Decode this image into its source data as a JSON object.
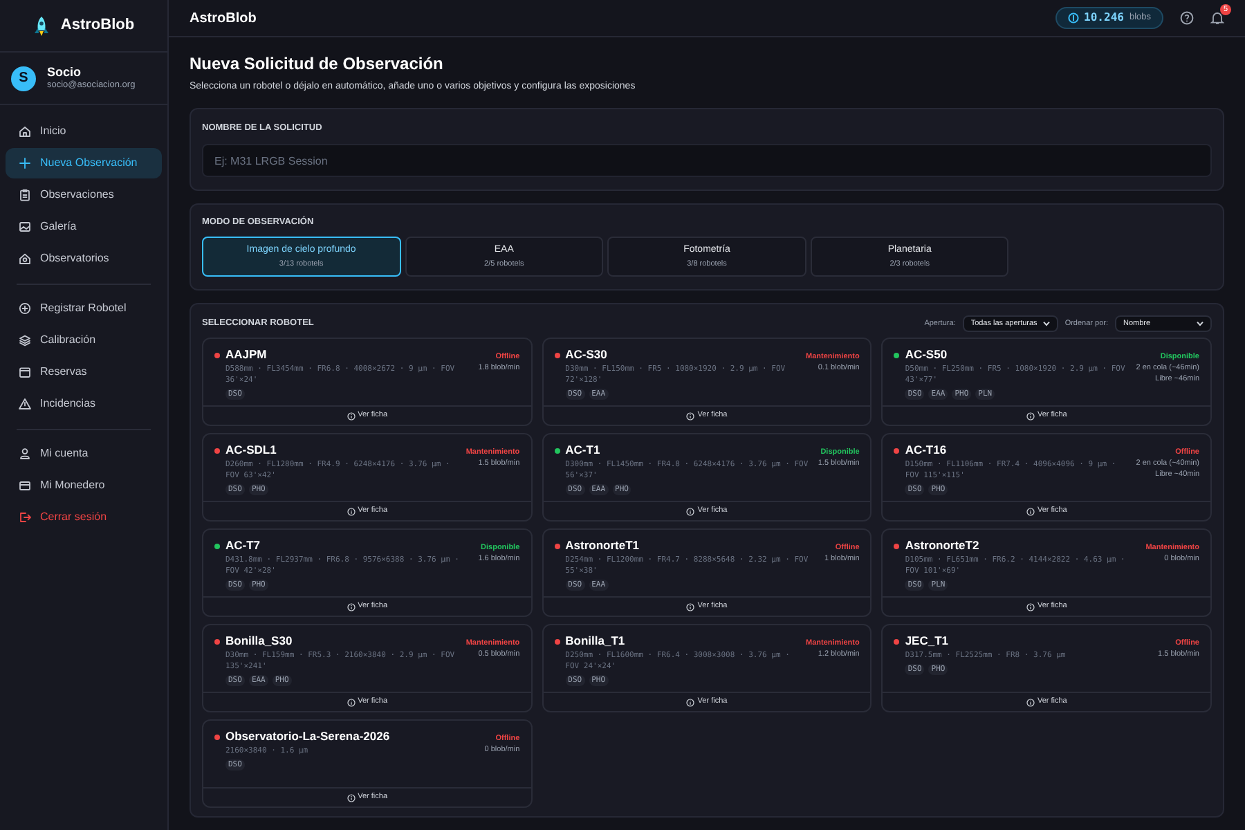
{
  "app": {
    "name": "AstroBlob"
  },
  "user": {
    "initial": "S",
    "name": "Socio",
    "email": "socio@asociacion.org"
  },
  "sidebar": {
    "sections": [
      {
        "items": [
          {
            "label": "Inicio",
            "selected": false,
            "kind": "normal"
          },
          {
            "label": "Nueva Observación",
            "selected": true,
            "kind": "normal"
          },
          {
            "label": "Observaciones",
            "selected": false,
            "kind": "normal"
          },
          {
            "label": "Galería",
            "selected": false,
            "kind": "normal"
          },
          {
            "label": "Observatorios",
            "selected": false,
            "kind": "normal"
          }
        ]
      },
      {
        "items": [
          {
            "label": "Registrar Robotel",
            "selected": false,
            "kind": "normal"
          },
          {
            "label": "Calibración",
            "selected": false,
            "kind": "normal"
          },
          {
            "label": "Reservas",
            "selected": false,
            "kind": "normal"
          },
          {
            "label": "Incidencias",
            "selected": false,
            "kind": "normal"
          }
        ]
      },
      {
        "items": [
          {
            "label": "Mi cuenta",
            "selected": false,
            "kind": "normal"
          },
          {
            "label": "Mi Monedero",
            "selected": false,
            "kind": "normal"
          },
          {
            "label": "Cerrar sesión",
            "selected": false,
            "kind": "danger"
          }
        ]
      }
    ]
  },
  "header": {
    "title": "AstroBlob",
    "balance": "10.246",
    "balance_unit": "blobs",
    "notifications": "5"
  },
  "page": {
    "title": "Nueva Solicitud de Observación",
    "subtitle": "Selecciona un robotel o déjalo en automático, añade uno o varios objetivos y configura las exposiciones"
  },
  "name_panel": {
    "label": "NOMBRE DE LA SOLICITUD",
    "placeholder": "Ej: M31 LRGB Session"
  },
  "mode_panel": {
    "label": "MODO DE OBSERVACIÓN",
    "modes": [
      {
        "label": "Imagen de cielo profundo",
        "count": "3/13 robotels",
        "selected": true
      },
      {
        "label": "EAA",
        "count": "2/5 robotels",
        "selected": false
      },
      {
        "label": "Fotometría",
        "count": "3/8 robotels",
        "selected": false
      },
      {
        "label": "Planetaria",
        "count": "2/3 robotels",
        "selected": false
      }
    ]
  },
  "robot_panel": {
    "label": "SELECCIONAR ROBOTEL",
    "aperture_label": "Apertura:",
    "aperture_value": "Todas las aperturas",
    "sort_label": "Ordenar por:",
    "sort_value": "Nombre",
    "robots": [
      {
        "name": "AAJPM",
        "specs": "D588mm · FL3454mm · FR6.8 · 4008×2672 · 9 µm · FOV 36'×24'",
        "tags": [
          "DSO"
        ],
        "status": "Offline",
        "color": "#ef4444",
        "details": [
          "1.8 blob/min"
        ],
        "link": "Ver ficha"
      },
      {
        "name": "AC-S30",
        "specs": "D30mm · FL150mm · FR5 · 1080×1920 · 2.9 µm · FOV 72'×128'",
        "tags": [
          "DSO",
          "EAA"
        ],
        "status": "Mantenimiento",
        "color": "#ef4444",
        "details": [
          "0.1 blob/min"
        ],
        "link": "Ver ficha"
      },
      {
        "name": "AC-S50",
        "specs": "D50mm · FL250mm · FR5 · 1080×1920 · 2.9 µm · FOV 43'×77'",
        "tags": [
          "DSO",
          "EAA",
          "PHO",
          "PLN"
        ],
        "status": "Disponible",
        "color": "#22c55e",
        "details": [
          "2 en cola (~46min)",
          "Libre ~46min"
        ],
        "link": "Ver ficha"
      },
      {
        "name": "AC-SDL1",
        "specs": "D260mm · FL1280mm · FR4.9 · 6248×4176 · 3.76 µm · FOV 63'×42'",
        "tags": [
          "DSO",
          "PHO"
        ],
        "status": "Mantenimiento",
        "color": "#ef4444",
        "details": [
          "1.5 blob/min"
        ],
        "link": "Ver ficha"
      },
      {
        "name": "AC-T1",
        "specs": "D300mm · FL1450mm · FR4.8 · 6248×4176 · 3.76 µm · FOV 56'×37'",
        "tags": [
          "DSO",
          "EAA",
          "PHO"
        ],
        "status": "Disponible",
        "color": "#22c55e",
        "details": [
          "1.5 blob/min"
        ],
        "link": "Ver ficha"
      },
      {
        "name": "AC-T16",
        "specs": "D150mm · FL1106mm · FR7.4 · 4096×4096 · 9 µm · FOV 115'×115'",
        "tags": [
          "DSO",
          "PHO"
        ],
        "status": "Offline",
        "color": "#ef4444",
        "details": [
          "2 en cola (~40min)",
          "Libre ~40min"
        ],
        "link": "Ver ficha"
      },
      {
        "name": "AC-T7",
        "specs": "D431.8mm · FL2937mm · FR6.8 · 9576×6388 · 3.76 µm · FOV 42'×28'",
        "tags": [
          "DSO",
          "PHO"
        ],
        "status": "Disponible",
        "color": "#22c55e",
        "details": [
          "1.6 blob/min"
        ],
        "link": "Ver ficha"
      },
      {
        "name": "AstronorteT1",
        "specs": "D254mm · FL1200mm · FR4.7 · 8288×5648 · 2.32 µm · FOV 55'×38'",
        "tags": [
          "DSO",
          "EAA"
        ],
        "status": "Offline",
        "color": "#ef4444",
        "details": [
          "1 blob/min"
        ],
        "link": "Ver ficha"
      },
      {
        "name": "AstronorteT2",
        "specs": "D105mm · FL651mm · FR6.2 · 4144×2822 · 4.63 µm · FOV 101'×69'",
        "tags": [
          "DSO",
          "PLN"
        ],
        "status": "Mantenimiento",
        "color": "#ef4444",
        "details": [
          "0 blob/min"
        ],
        "link": "Ver ficha"
      },
      {
        "name": "Bonilla_S30",
        "specs": "D30mm · FL159mm · FR5.3 · 2160×3840 · 2.9 µm · FOV 135'×241'",
        "tags": [
          "DSO",
          "EAA",
          "PHO"
        ],
        "status": "Mantenimiento",
        "color": "#ef4444",
        "details": [
          "0.5 blob/min"
        ],
        "link": "Ver ficha"
      },
      {
        "name": "Bonilla_T1",
        "specs": "D250mm · FL1600mm · FR6.4 · 3008×3008 · 3.76 µm · FOV 24'×24'",
        "tags": [
          "DSO",
          "PHO"
        ],
        "status": "Mantenimiento",
        "color": "#ef4444",
        "details": [
          "1.2 blob/min"
        ],
        "link": "Ver ficha"
      },
      {
        "name": "JEC_T1",
        "specs": "D317.5mm · FL2525mm · FR8 · 3.76 µm",
        "tags": [
          "DSO",
          "PHO"
        ],
        "status": "Offline",
        "color": "#ef4444",
        "details": [
          "1.5 blob/min"
        ],
        "link": "Ver ficha"
      },
      {
        "name": "Observatorio-La-Serena-2026",
        "specs": "2160×3840 · 1.6 µm",
        "tags": [
          "DSO"
        ],
        "status": "Offline",
        "color": "#ef4444",
        "details": [
          "0 blob/min"
        ],
        "link": "Ver ficha"
      }
    ]
  }
}
